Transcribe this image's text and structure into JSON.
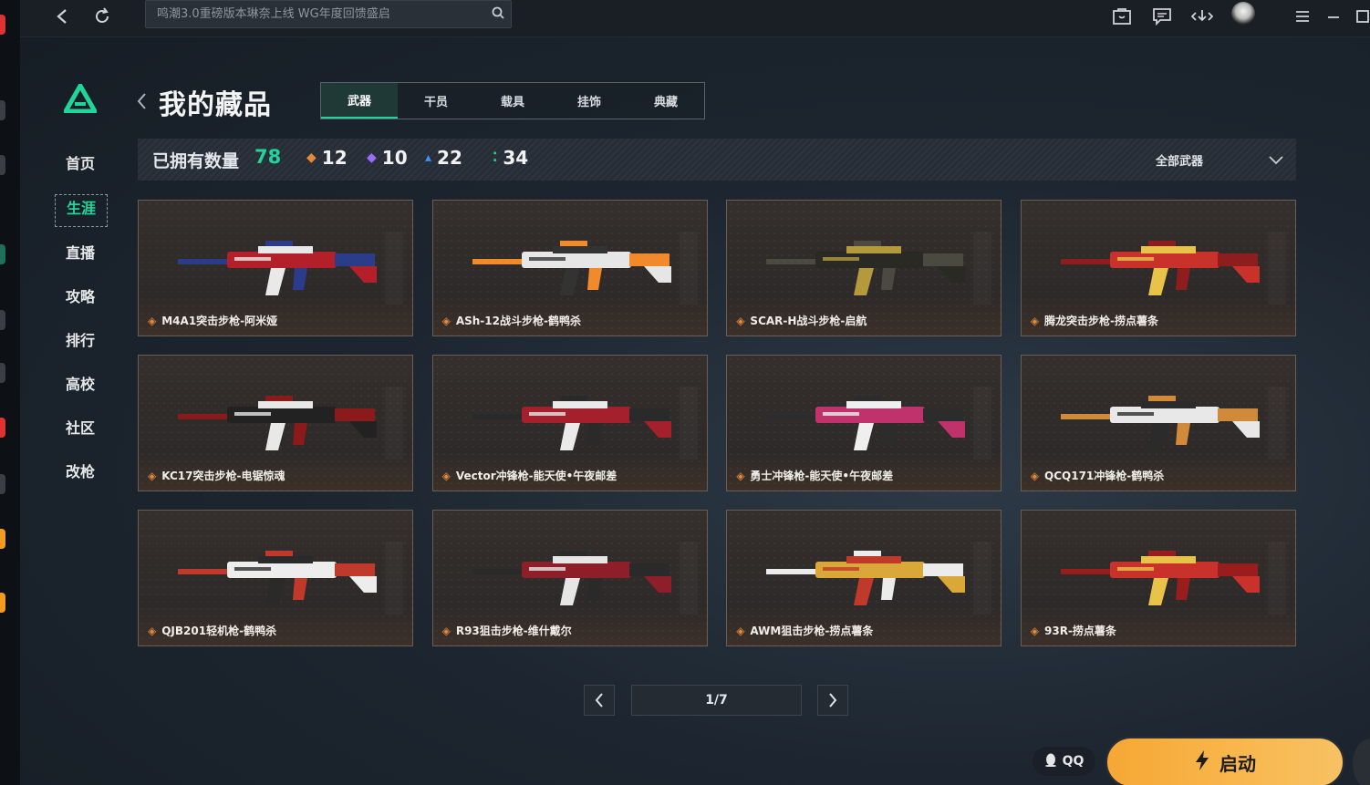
{
  "topbar": {
    "search_placeholder": "鸣潮3.0重磅版本琳奈上线 WG年度回馈盛启",
    "icons": [
      "back-icon",
      "refresh-icon",
      "search-icon",
      "bag-icon",
      "message-icon",
      "download-icon",
      "avatar",
      "menu-icon",
      "minimize-icon",
      "maximize-icon"
    ]
  },
  "sidebar": {
    "items": [
      {
        "label": "首页"
      },
      {
        "label": "生涯"
      },
      {
        "label": "直播"
      },
      {
        "label": "攻略"
      },
      {
        "label": "排行"
      },
      {
        "label": "高校"
      },
      {
        "label": "社区"
      },
      {
        "label": "改枪"
      }
    ],
    "active_index": 1
  },
  "page": {
    "title": "我的藏品",
    "tabs": [
      "武器",
      "干员",
      "载具",
      "挂饰",
      "典藏"
    ],
    "active_tab": 0
  },
  "stats": {
    "owned_label": "已拥有数量",
    "owned_count": "78",
    "rarities": [
      {
        "color": "#e2893b",
        "count": "12"
      },
      {
        "color": "#9d6cff",
        "count": "10"
      },
      {
        "color": "#3d8df5",
        "count": "22"
      },
      {
        "color": "#2fd08a",
        "count": "34"
      }
    ],
    "filter_label": "全部武器"
  },
  "items": [
    {
      "name": "M4A1突击步枪-阿米娅",
      "palette": [
        "#b3202a",
        "#e9e9e9",
        "#2b3c8a"
      ]
    },
    {
      "name": "ASh-12战斗步枪-鹤鸭杀",
      "palette": [
        "#e6e6e6",
        "#333333",
        "#f08a2b"
      ]
    },
    {
      "name": "SCAR-H战斗步枪-启航",
      "palette": [
        "#2a2a24",
        "#b59a3d",
        "#4a4a40"
      ]
    },
    {
      "name": "腾龙突击步枪-捞点薯条",
      "palette": [
        "#c8322b",
        "#e9c24a",
        "#8e1d1d"
      ]
    },
    {
      "name": "KC17突击步枪-电锯惊魂",
      "palette": [
        "#222222",
        "#e8e8e8",
        "#8b1a1a"
      ]
    },
    {
      "name": "Vector冲锋枪-能天使•午夜邮差",
      "palette": [
        "#a3202c",
        "#eaeaea",
        "#2a2a2a"
      ]
    },
    {
      "name": "勇士冲锋枪-能天使•午夜邮差",
      "palette": [
        "#c0326c",
        "#efefef",
        "#2c2c2c"
      ]
    },
    {
      "name": "QCQ171冲锋枪-鹤鸭杀",
      "palette": [
        "#e8e8e8",
        "#2b2b2b",
        "#d08a3a"
      ]
    },
    {
      "name": "QJB201轻机枪-鹤鸭杀",
      "palette": [
        "#ededed",
        "#2a2a2a",
        "#c0392b"
      ]
    },
    {
      "name": "R93狙击步枪-维什戴尔",
      "palette": [
        "#8e1f2a",
        "#e6e6e6",
        "#2a2a2a"
      ]
    },
    {
      "name": "AWM狙击步枪-捞点薯条",
      "palette": [
        "#d9a838",
        "#c0392b",
        "#ececec"
      ]
    },
    {
      "name": "93R-捞点薯条",
      "palette": [
        "#c8322b",
        "#e9c24a",
        "#9a1d1d"
      ]
    }
  ],
  "pager": {
    "label": "1/7"
  },
  "bottom": {
    "qq_label": "QQ",
    "launch_label": "启动"
  }
}
